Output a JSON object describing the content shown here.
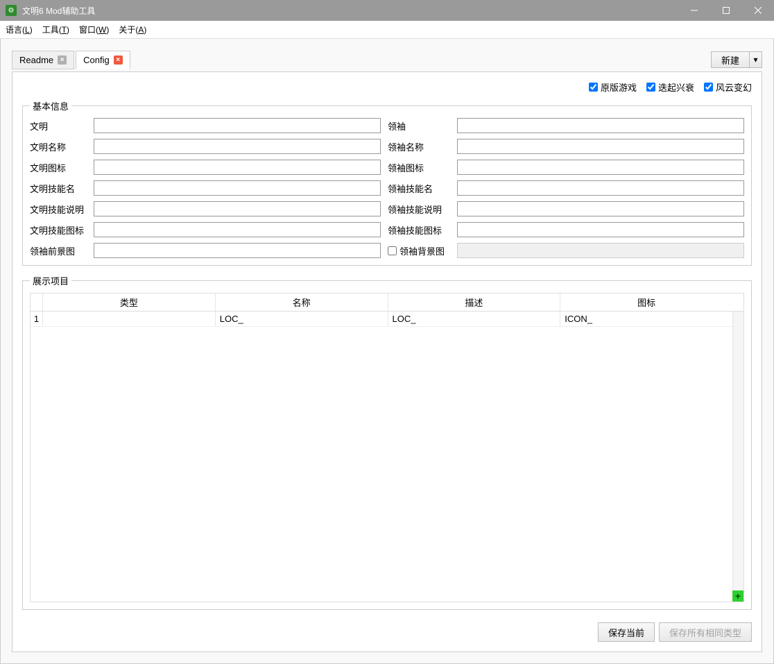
{
  "title": "文明6 Mod辅助工具",
  "menu": {
    "lang": "语言(L)",
    "tools": "工具(T)",
    "window": "窗口(W)",
    "about": "关于(A)"
  },
  "tabs": {
    "readme": "Readme",
    "config": "Config"
  },
  "toolbar": {
    "newbtn": "新建"
  },
  "checkboxes": {
    "vanilla": "原版游戏",
    "risefall": "迭起兴衰",
    "gathering": "风云变幻"
  },
  "basic_info": {
    "legend": "基本信息",
    "labels": {
      "civ": "文明",
      "civ_name": "文明名称",
      "civ_icon": "文明图标",
      "civ_skill_name": "文明技能名",
      "civ_skill_desc": "文明技能说明",
      "civ_skill_icon": "文明技能图标",
      "leader_fg": "领袖前景图",
      "leader": "领袖",
      "leader_name": "领袖名称",
      "leader_icon": "领袖图标",
      "leader_skill_name": "领袖技能名",
      "leader_skill_desc": "领袖技能说明",
      "leader_skill_icon": "领袖技能图标",
      "leader_bg": "领袖背景图"
    },
    "values": {
      "civ": "",
      "civ_name": "",
      "civ_icon": "",
      "civ_skill_name": "",
      "civ_skill_desc": "",
      "civ_skill_icon": "",
      "leader_fg": "",
      "leader": "",
      "leader_name": "",
      "leader_icon": "",
      "leader_skill_name": "",
      "leader_skill_desc": "",
      "leader_skill_icon": ""
    }
  },
  "display": {
    "legend": "展示项目",
    "headers": {
      "type": "类型",
      "name": "名称",
      "desc": "描述",
      "icon": "图标"
    },
    "rows": [
      {
        "idx": "1",
        "type": "",
        "name": "LOC_",
        "desc": "LOC_",
        "icon": "ICON_"
      }
    ]
  },
  "buttons": {
    "save_current": "保存当前",
    "save_all_same": "保存所有相同类型"
  }
}
